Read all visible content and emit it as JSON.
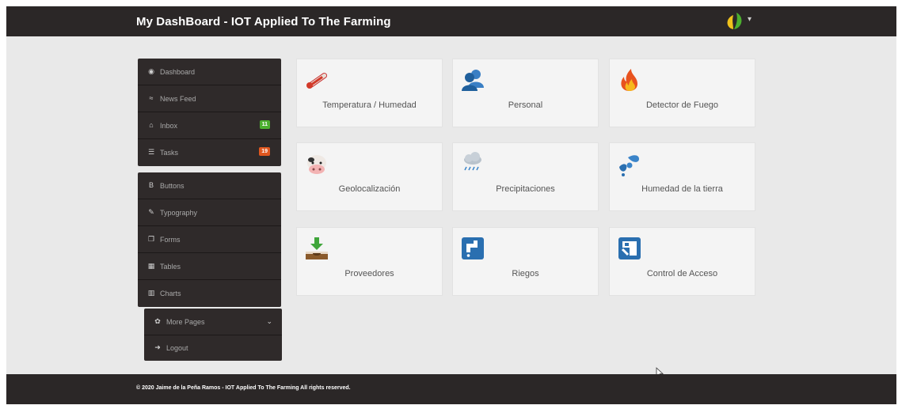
{
  "header": {
    "title": "My DashBoard - IOT Applied To The Farming"
  },
  "sidebar": {
    "group1": [
      {
        "label": "Dashboard",
        "icon": "dashboard-icon"
      },
      {
        "label": "News Feed",
        "icon": "rss-icon"
      },
      {
        "label": "Inbox",
        "icon": "inbox-icon",
        "badge": "11",
        "badge_color": "#4caf2f"
      },
      {
        "label": "Tasks",
        "icon": "tasks-icon",
        "badge": "19",
        "badge_color": "#e0571f"
      }
    ],
    "group2": [
      {
        "label": "Buttons",
        "icon": "bold-icon"
      },
      {
        "label": "Typography",
        "icon": "pencil-icon"
      },
      {
        "label": "Forms",
        "icon": "files-icon"
      },
      {
        "label": "Tables",
        "icon": "table-icon"
      },
      {
        "label": "Charts",
        "icon": "chart-icon"
      }
    ],
    "group3": [
      {
        "label": "More Pages",
        "icon": "gear-icon"
      },
      {
        "label": "Logout",
        "icon": "logout-icon"
      }
    ]
  },
  "tiles": [
    {
      "label": "Temperatura / Humedad",
      "icon": "thermometer-icon"
    },
    {
      "label": "Personal",
      "icon": "people-icon"
    },
    {
      "label": "Detector de Fuego",
      "icon": "fire-icon"
    },
    {
      "label": "Geolocalización",
      "icon": "cow-icon"
    },
    {
      "label": "Precipitaciones",
      "icon": "rain-cloud-icon"
    },
    {
      "label": "Humedad de la tierra",
      "icon": "water-drops-icon"
    },
    {
      "label": "Proveedores",
      "icon": "planting-icon"
    },
    {
      "label": "Riegos",
      "icon": "tap-icon"
    },
    {
      "label": "Control de Acceso",
      "icon": "access-control-icon"
    }
  ],
  "colors": {
    "topbar": "#2b2727",
    "sidebar": "#2f2a2a",
    "tile_bg": "#f4f4f4",
    "inbox_badge": "#4caf2f",
    "tasks_badge": "#e0571f"
  },
  "footer": {
    "text": "© 2020 Jaime de la Peña Ramos - IOT Applied To The Farming All rights reserved."
  }
}
